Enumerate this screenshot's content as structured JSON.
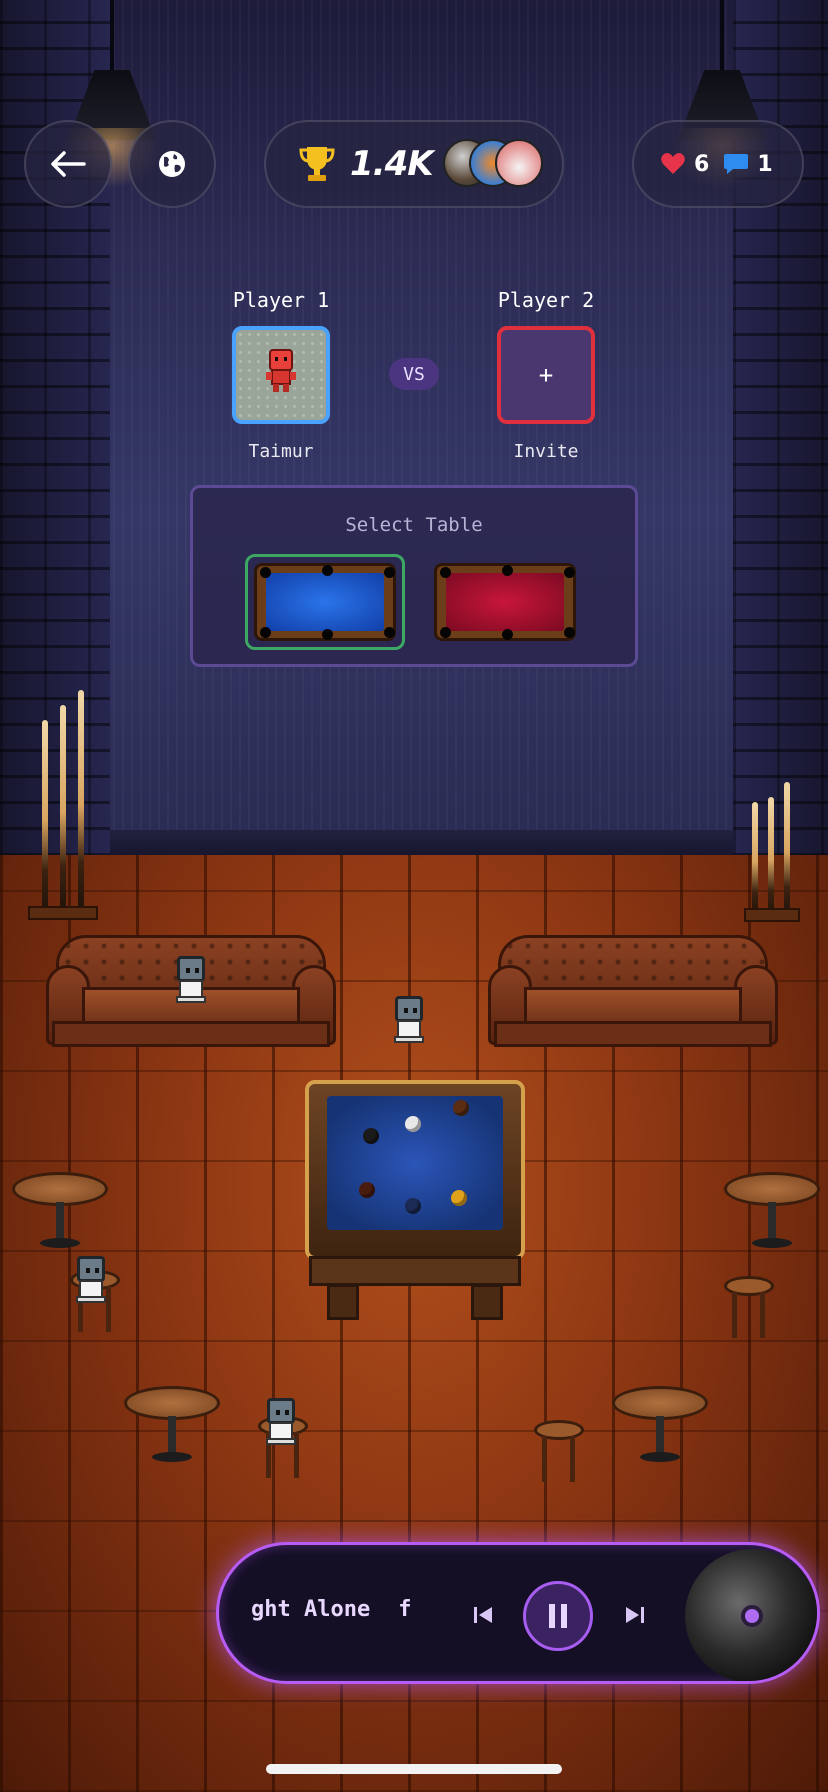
{
  "hud": {
    "score": "1.4K",
    "likes": "6",
    "comments": "1"
  },
  "match": {
    "player1_label": "Player 1",
    "player1_name": "Taimur",
    "vs": "VS",
    "player2_label": "Player 2",
    "player2_slot": "+",
    "player2_name": "Invite",
    "select_table_title": "Select Table",
    "tables": [
      {
        "color": "#2a74ea",
        "selected": true
      },
      {
        "color": "#c8163a",
        "selected": false
      }
    ]
  },
  "music": {
    "track_title": "ght Alone",
    "next_fragment": "f"
  },
  "colors": {
    "accent_purple": "#b85cf6",
    "player1_border": "#4aa2ff",
    "player2_border": "#e0303e",
    "selected_table_border": "#3da864",
    "heart": "#e8344a",
    "chat": "#2e8cf0",
    "trophy": "#f4c020"
  }
}
